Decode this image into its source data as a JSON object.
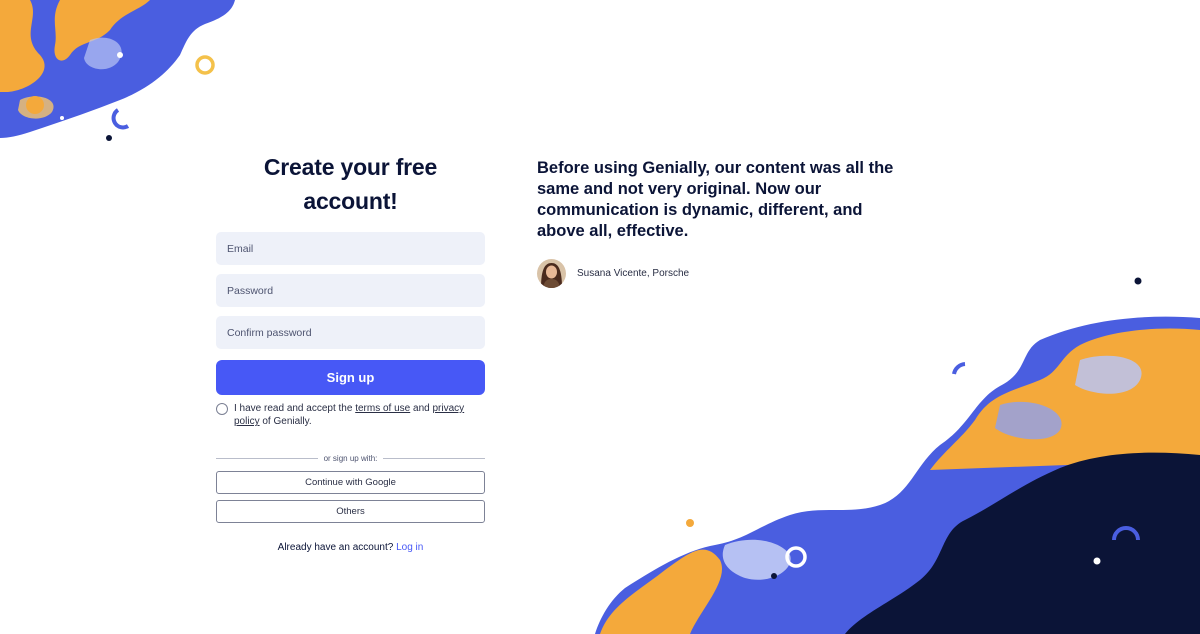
{
  "signup_form": {
    "title": "Create your free account!",
    "email_placeholder": "Email",
    "password_placeholder": "Password",
    "confirm_password_placeholder": "Confirm password",
    "signup_label": "Sign up",
    "terms_prefix": "I have read and accept the",
    "terms_link": "terms of use",
    "terms_and": "and",
    "privacy_link": "privacy policy",
    "terms_suffix": "of Genially.",
    "divider_text": "or sign up with:",
    "google_label": "Continue with Google",
    "others_label": "Others",
    "login_prompt": "Already have an account?",
    "login_link": "Log in"
  },
  "testimonial": {
    "quote": "Before using Genially, our content was all the same and not very original. Now our communication is dynamic, different, and above all, effective.",
    "author": "Susana Vicente, Porsche"
  },
  "colors": {
    "accent": "#4758f6",
    "heading": "#0b1437",
    "field_bg": "#eef1f9",
    "paint_blue": "#4a5ee0",
    "paint_orange": "#f4a93b",
    "paint_navy": "#0b1437"
  }
}
